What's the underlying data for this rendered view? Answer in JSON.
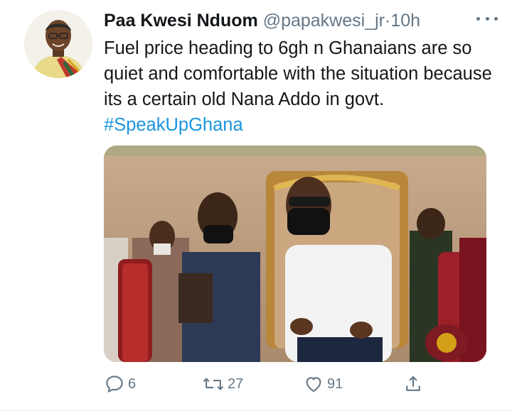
{
  "tweet": {
    "author_name": "Paa Kwesi Nduom",
    "handle": "@papakwesi_jr",
    "separator": "·",
    "time": "10h",
    "text_plain": "Fuel price heading to 6gh n Ghanaians are so quiet and comfortable with the situation because its a certain old Nana Addo in govt. ",
    "hashtag": "#SpeakUpGhana"
  },
  "actions": {
    "reply_count": "6",
    "retweet_count": "27",
    "like_count": "91"
  },
  "icons": {
    "more": "more-horizontal-icon",
    "reply": "reply-icon",
    "retweet": "retweet-icon",
    "like": "heart-icon",
    "share": "share-icon"
  },
  "colors": {
    "text": "#14171a",
    "secondary": "#657786",
    "link": "#1b95e0"
  }
}
